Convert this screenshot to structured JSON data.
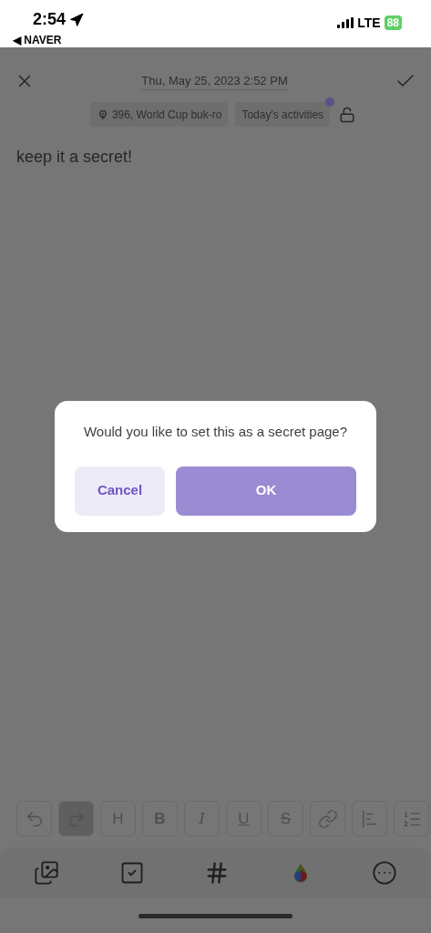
{
  "status_bar": {
    "time": "2:54",
    "back_app": "◀ NAVER",
    "network": "LTE",
    "battery": "88"
  },
  "header": {
    "date": "Thu, May 25, 2023 2:52 PM"
  },
  "chips": [
    {
      "kind": "location",
      "label": "396, World Cup buk-ro",
      "badge": false
    },
    {
      "kind": "tag",
      "label": "Today's activities",
      "badge": true
    }
  ],
  "lock": {
    "locked": false
  },
  "body": "keep it a secret!",
  "dialog": {
    "message": "Would you like to set this as a secret page?",
    "cancel": "Cancel",
    "ok": "OK"
  },
  "format_buttons": [
    {
      "kind": "undo",
      "selected": false
    },
    {
      "kind": "redo",
      "selected": true
    },
    {
      "kind": "heading",
      "label": "H",
      "selected": false
    },
    {
      "kind": "bold",
      "label": "B",
      "selected": false
    },
    {
      "kind": "italic",
      "label": "I",
      "selected": false
    },
    {
      "kind": "underline",
      "label": "U",
      "selected": false
    },
    {
      "kind": "strike",
      "label": "S",
      "selected": false
    },
    {
      "kind": "link",
      "selected": false
    },
    {
      "kind": "align",
      "selected": false
    },
    {
      "kind": "list",
      "selected": false
    }
  ],
  "bottom_tools": [
    {
      "kind": "image"
    },
    {
      "kind": "checkbox"
    },
    {
      "kind": "hashtag"
    },
    {
      "kind": "color"
    },
    {
      "kind": "more"
    }
  ]
}
